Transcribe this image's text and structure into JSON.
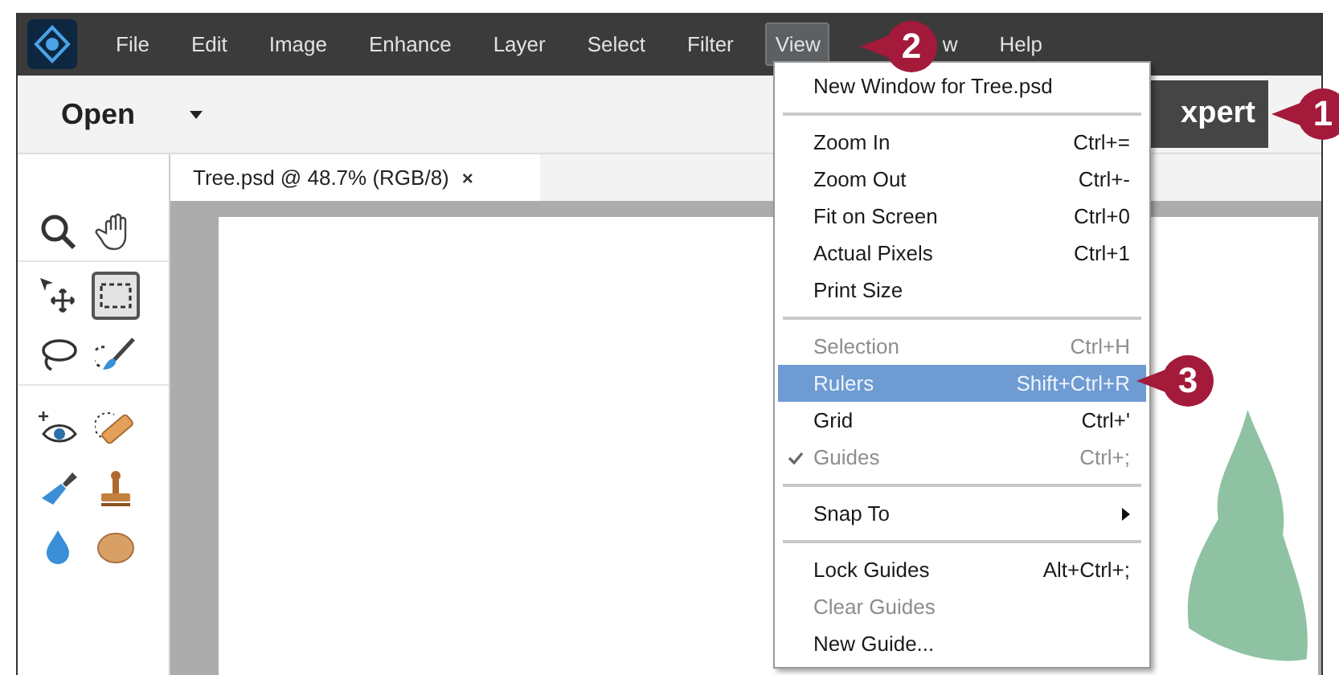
{
  "menubar": [
    {
      "label": "File",
      "selected": false
    },
    {
      "label": "Edit",
      "selected": false
    },
    {
      "label": "Image",
      "selected": false
    },
    {
      "label": "Enhance",
      "selected": false
    },
    {
      "label": "Layer",
      "selected": false
    },
    {
      "label": "Select",
      "selected": false
    },
    {
      "label": "Filter",
      "selected": false
    },
    {
      "label": "View",
      "selected": true
    },
    {
      "label": "w",
      "selected": false
    },
    {
      "label": "Help",
      "selected": false
    }
  ],
  "toolbar": {
    "open_label": "Open",
    "mode_button": "xpert"
  },
  "document_tab": {
    "title": "Tree.psd @ 48.7% (RGB/8)",
    "close": "×"
  },
  "tools": [
    {
      "selected": false
    },
    {
      "selected": false
    },
    {
      "selected": false
    },
    {
      "selected": true
    },
    {
      "selected": false
    },
    {
      "selected": false
    },
    {
      "selected": false
    },
    {
      "selected": false
    },
    {
      "selected": false
    },
    {
      "selected": false
    },
    {
      "selected": false
    },
    {
      "selected": false
    }
  ],
  "view_menu": [
    {
      "kind": "item",
      "label": "New Window for Tree.psd",
      "disabled": false,
      "checked": false,
      "selected": false
    },
    {
      "kind": "separator"
    },
    {
      "kind": "item",
      "label": "Zoom In",
      "shortcut": "Ctrl+=",
      "disabled": false,
      "checked": false,
      "selected": false
    },
    {
      "kind": "item",
      "label": "Zoom Out",
      "shortcut": "Ctrl+-",
      "disabled": false,
      "checked": false,
      "selected": false
    },
    {
      "kind": "item",
      "label": "Fit on Screen",
      "shortcut": "Ctrl+0",
      "disabled": false,
      "checked": false,
      "selected": false
    },
    {
      "kind": "item",
      "label": "Actual Pixels",
      "shortcut": "Ctrl+1",
      "disabled": false,
      "checked": false,
      "selected": false
    },
    {
      "kind": "item",
      "label": "Print Size",
      "disabled": false,
      "checked": false,
      "selected": false
    },
    {
      "kind": "separator"
    },
    {
      "kind": "item",
      "label": "Selection",
      "shortcut": "Ctrl+H",
      "disabled": true,
      "checked": false,
      "selected": false
    },
    {
      "kind": "item",
      "label": "Rulers",
      "shortcut": "Shift+Ctrl+R",
      "disabled": false,
      "checked": false,
      "selected": true
    },
    {
      "kind": "item",
      "label": "Grid",
      "shortcut": "Ctrl+'",
      "disabled": false,
      "checked": false,
      "selected": false
    },
    {
      "kind": "item",
      "label": "Guides",
      "shortcut": "Ctrl+;",
      "disabled": true,
      "checked": true,
      "selected": false
    },
    {
      "kind": "separator"
    },
    {
      "kind": "submenu",
      "label": "Snap To",
      "disabled": false,
      "checked": false,
      "selected": false
    },
    {
      "kind": "separator"
    },
    {
      "kind": "item",
      "label": "Lock Guides",
      "shortcut": "Alt+Ctrl+;",
      "disabled": false,
      "checked": false,
      "selected": false
    },
    {
      "kind": "item",
      "label": "Clear Guides",
      "disabled": true,
      "checked": false,
      "selected": false
    },
    {
      "kind": "item",
      "label": "New Guide...",
      "disabled": false,
      "checked": false,
      "selected": false
    }
  ],
  "callouts": [
    "1",
    "2",
    "3"
  ]
}
